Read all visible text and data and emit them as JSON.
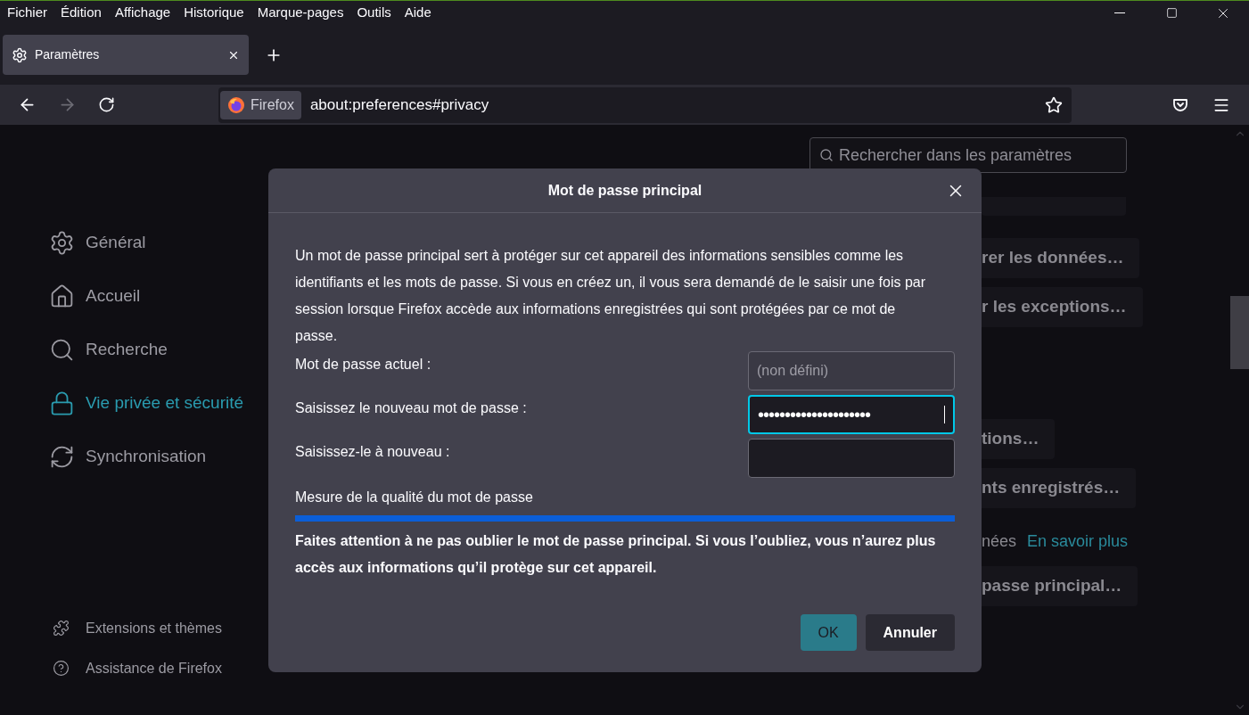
{
  "menu_bar": [
    "Fichier",
    "Édition",
    "Affichage",
    "Historique",
    "Marque-pages",
    "Outils",
    "Aide"
  ],
  "tabs": [
    {
      "label": "Paramètres",
      "selected": true
    }
  ],
  "url_bar": {
    "identity": "Firefox",
    "url": "about:preferences#privacy"
  },
  "sidebar": {
    "items": [
      {
        "label": "Général",
        "selected": false
      },
      {
        "label": "Accueil",
        "selected": false
      },
      {
        "label": "Recherche",
        "selected": false
      },
      {
        "label": "Vie privée et sécurité",
        "selected": true
      },
      {
        "label": "Synchronisation",
        "selected": false
      }
    ],
    "footer": [
      "Extensions et thèmes",
      "Assistance de Firefox"
    ]
  },
  "search": {
    "placeholder": "Rechercher dans les paramètres"
  },
  "background_items": [
    {
      "kind": "blank"
    },
    {
      "kind": "button",
      "text": "rer les données…"
    },
    {
      "kind": "button",
      "text": "r les exceptions…"
    },
    {
      "kind": "gap"
    },
    {
      "kind": "button",
      "text": "tions…"
    },
    {
      "kind": "button",
      "text": "nts enregistrés…"
    },
    {
      "kind": "text",
      "text": "nées",
      "link": "En savoir plus"
    },
    {
      "kind": "button",
      "text": "passe principal…"
    }
  ],
  "dialog": {
    "title": "Mot de passe principal",
    "description": "Un mot de passe principal sert à protéger sur cet appareil des informations sensibles comme les identifiants et les mots de passe. Si vous en créez un, il vous sera demandé de le saisir une fois par session lorsque Firefox accède aux informations enregistrées qui sont protégées par ce mot de passe.",
    "fields": [
      {
        "label": "Mot de passe actuel :",
        "placeholder": "(non défini)",
        "disabled": true,
        "focused": false
      },
      {
        "label": "Saisissez le nouveau mot de passe :",
        "value": "•••••••••••••••••••••",
        "disabled": false,
        "focused": true
      },
      {
        "label": "Saisissez-le à nouveau :",
        "disabled": false,
        "focused": false
      }
    ],
    "meter": {
      "label": "Mesure de la qualité du mot de passe",
      "level": 1
    },
    "warning": "Faites attention à ne pas oublier le mot de passe principal. Si vous l’oubliez, vous n’aurez plus accès aux informations qu’il protège sur cet appareil.",
    "buttons": [
      {
        "label": "OK",
        "primary": true
      },
      {
        "label": "Annuler",
        "primary": false
      }
    ]
  }
}
